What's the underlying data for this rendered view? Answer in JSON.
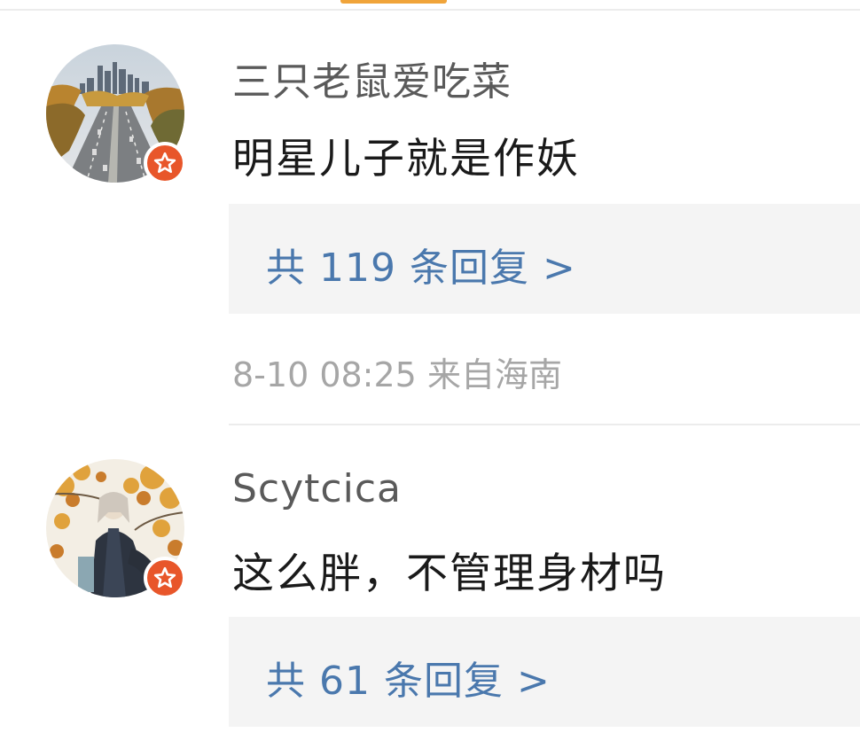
{
  "theme": {
    "link_color": "#4a78ad",
    "badge_color": "#e8562a",
    "reply_box_bg": "#f4f4f4",
    "tab_indicator_color": "#f0a43a"
  },
  "comments": [
    {
      "avatar": "city-highway-avatar",
      "badge": "star-badge-icon",
      "username": "三只老鼠爱吃菜",
      "text": "明星儿子就是作妖",
      "replies_label": "共 119 条回复 >",
      "time": "8-10 08:25",
      "location": "来自海南"
    },
    {
      "avatar": "anime-character-autumn-avatar",
      "badge": "star-badge-icon",
      "username": "Scytcica",
      "text": "这么胖，不管理身材吗",
      "replies_label": "共 61 条回复 >"
    }
  ]
}
